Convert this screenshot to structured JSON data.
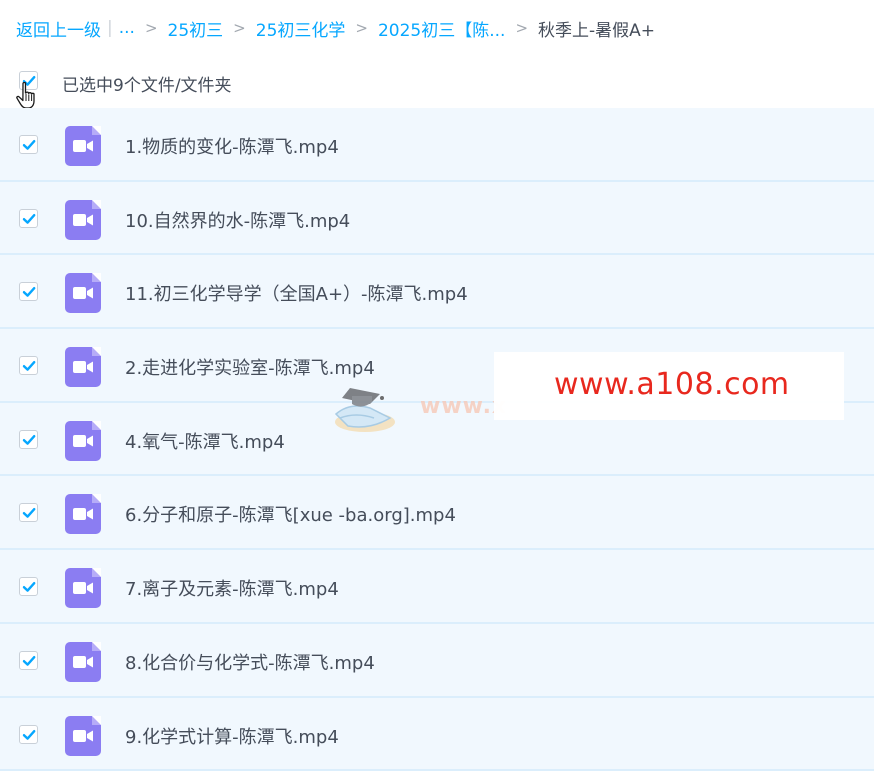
{
  "breadcrumb": {
    "back": "返回上一级",
    "ellipsis": "...",
    "crumbs": [
      "25初三",
      "25初三化学",
      "2025初三【陈..."
    ],
    "current": "秋季上-暑假A+"
  },
  "selection": {
    "summary": "已选中9个文件/文件夹",
    "all_checked": true
  },
  "files": [
    {
      "name": "1.物质的变化-陈潭飞.mp4",
      "checked": true
    },
    {
      "name": "10.自然界的水-陈潭飞.mp4",
      "checked": true
    },
    {
      "name": "11.初三化学导学（全国A+）-陈潭飞.mp4",
      "checked": true
    },
    {
      "name": "2.走进化学实验室-陈潭飞.mp4",
      "checked": true
    },
    {
      "name": "4.氧气-陈潭飞.mp4",
      "checked": true
    },
    {
      "name": "6.分子和原子-陈潭飞[xue -ba.org].mp4",
      "checked": true
    },
    {
      "name": "7.离子及元素-陈潭飞.mp4",
      "checked": true
    },
    {
      "name": "8.化合价与化学式-陈潭飞.mp4",
      "checked": true
    },
    {
      "name": "9.化学式计算-陈潭飞.mp4",
      "checked": true
    }
  ],
  "watermark": {
    "text": "www.a108.com",
    "faint_text": "www.x"
  },
  "colors": {
    "accent": "#06a7ff",
    "row_bg": "#f1f8fe",
    "video_icon": "#8b7df2",
    "watermark": "#e8281e"
  }
}
